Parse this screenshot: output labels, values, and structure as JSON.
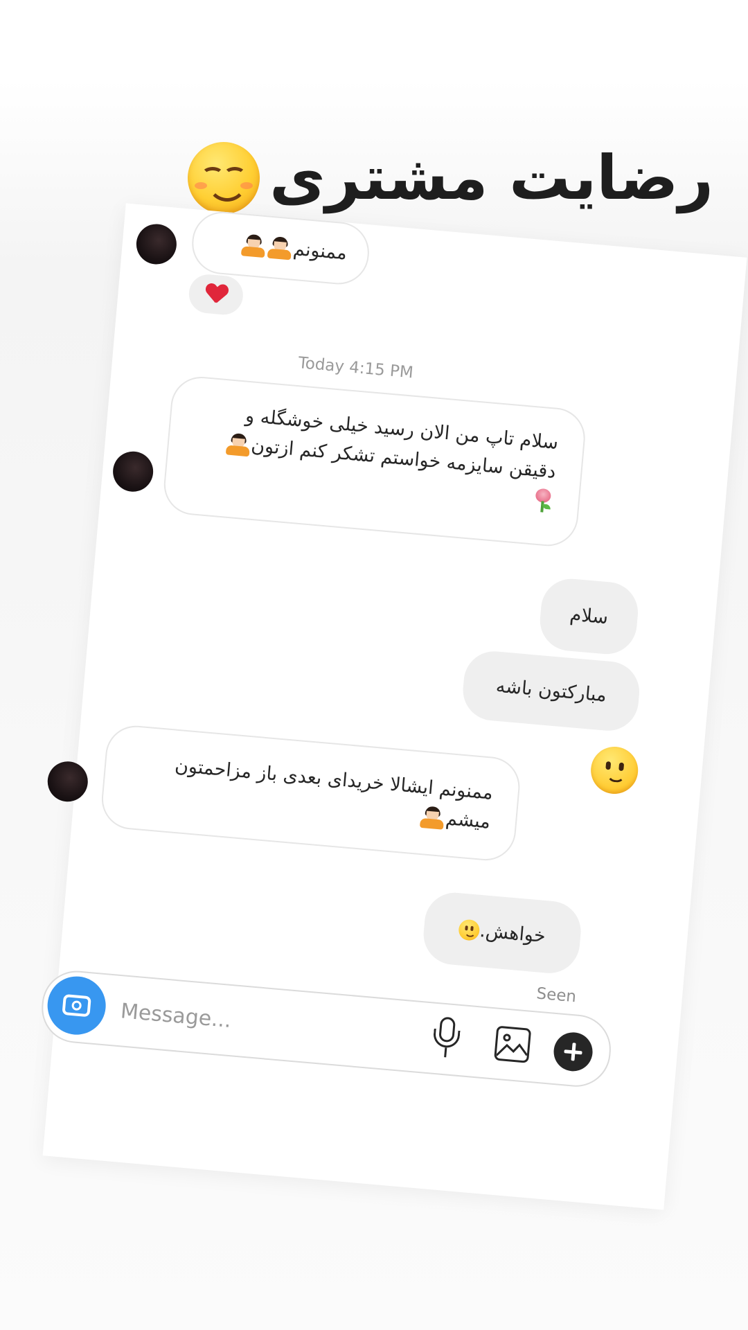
{
  "header": {
    "title": "رضایت مشتری"
  },
  "chat": {
    "messages": [
      {
        "id": "m1",
        "direction": "incoming",
        "text": "ممنونم"
      },
      {
        "id": "m2",
        "direction": "incoming",
        "text_line1": "سلام تاپ من الان رسید خیلی خوشگله و",
        "text_line2": "دقیقن سایزمه خواستم تشکر کنم ازتون"
      },
      {
        "id": "m3",
        "direction": "outgoing",
        "text": "سلام"
      },
      {
        "id": "m4",
        "direction": "outgoing",
        "text": "مبارکتون باشه"
      },
      {
        "id": "m5",
        "direction": "incoming",
        "text_line1": "ممنونم ایشالا خریدای بعدی باز مزاحمتون",
        "text_line2": "میشم"
      },
      {
        "id": "m6",
        "direction": "outgoing",
        "text": "خواهش."
      }
    ],
    "timestamp": "Today 4:15 PM",
    "seen": "Seen"
  },
  "composer": {
    "placeholder": "Message..."
  },
  "icons": {
    "reaction": "heart-icon",
    "camera": "camera-icon",
    "mic": "microphone-icon",
    "gallery": "gallery-icon",
    "add": "plus-icon"
  },
  "colors": {
    "accent": "#3897f0",
    "outgoing_bubble": "#efefef",
    "heart": "#e0263a"
  }
}
